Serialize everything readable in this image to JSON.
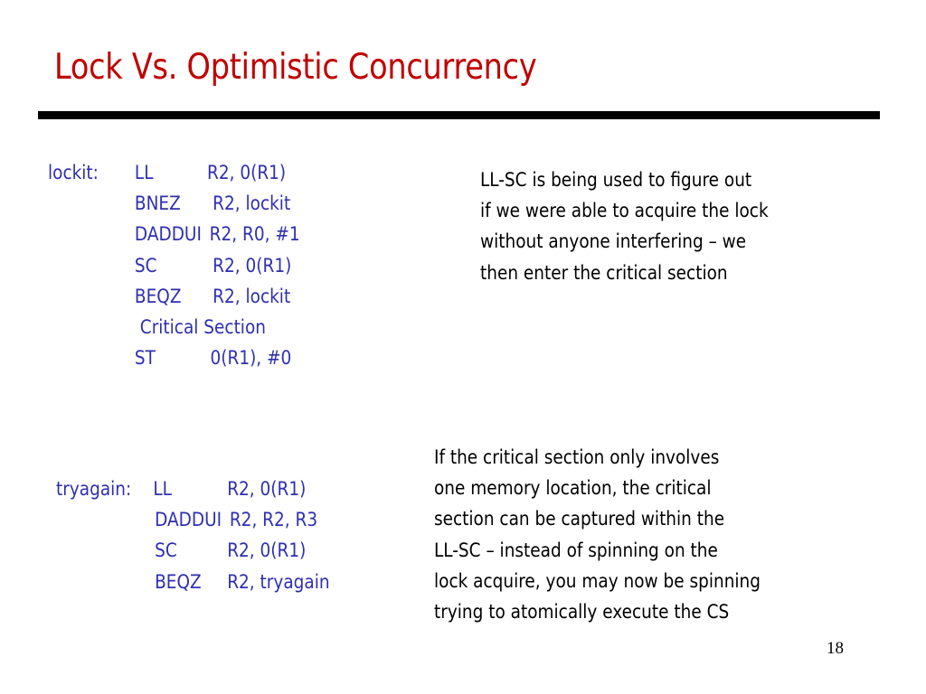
{
  "slide": {
    "title": "Lock Vs. Optimistic Concurrency",
    "page_number": "18",
    "colors": {
      "title": "#c00000",
      "code": "#2f2fb0",
      "body": "#000000",
      "rule": "#000000"
    }
  },
  "code_block_1": {
    "lines": [
      {
        "label": "lockit:",
        "op": "LL",
        "args": "R2, 0(R1)"
      },
      {
        "label": "",
        "op": "BNEZ",
        "args": "R2, lockit"
      },
      {
        "label": "",
        "op": "DADDUI",
        "args": "R2, R0, #1"
      },
      {
        "label": "",
        "op": "SC",
        "args": "R2, 0(R1)"
      },
      {
        "label": "",
        "op": "BEQZ",
        "args": "R2, lockit"
      },
      {
        "label": "",
        "op": " Critical Section",
        "args": ""
      },
      {
        "label": "",
        "op": "ST",
        "args": "0(R1), #0"
      }
    ]
  },
  "code_block_2": {
    "lines": [
      {
        "label": "tryagain:",
        "op": "LL",
        "args": "R2, 0(R1)"
      },
      {
        "label": "",
        "op": "DADDUI",
        "args": "R2, R2, R3"
      },
      {
        "label": "",
        "op": "SC",
        "args": "R2, 0(R1)"
      },
      {
        "label": "",
        "op": "BEQZ",
        "args": "R2, tryagain"
      }
    ]
  },
  "note_1": {
    "lines": [
      "LL-SC is being used to figure out",
      "if we were able to acquire the lock",
      "without anyone interfering – we",
      "then enter the critical section"
    ]
  },
  "note_2": {
    "lines": [
      "If the critical section only involves",
      "one memory location, the critical",
      "section can be captured within the",
      "LL-SC – instead of spinning on the",
      "lock acquire, you may now be spinning",
      "trying to atomically execute the CS"
    ]
  }
}
